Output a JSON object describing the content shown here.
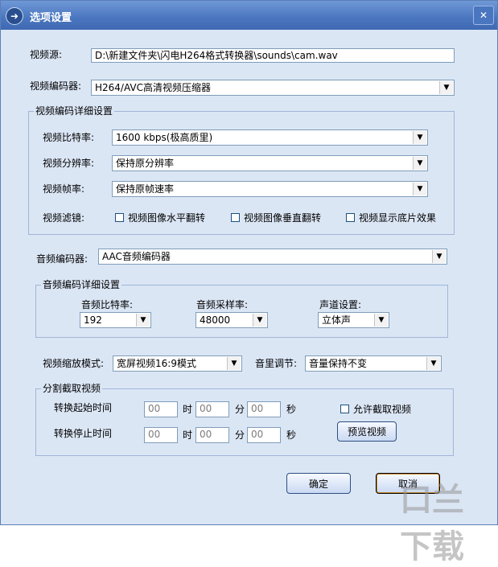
{
  "window": {
    "title": "选项设置"
  },
  "video_source": {
    "label": "视频源:",
    "value": "D:\\新建文件夹\\闪电H264格式转换器\\sounds\\cam.wav"
  },
  "video_encoder": {
    "label": "视频编码器:",
    "value": "H264/AVC高清视频压缩器"
  },
  "video_detail": {
    "title": "视频编码详细设置",
    "bitrate": {
      "label": "视频比特率:",
      "value": "1600 kbps(极高质里)"
    },
    "resolution": {
      "label": "视频分辨率:",
      "value": "保持原分辨率"
    },
    "framerate": {
      "label": "视频帧率:",
      "value": "保持原帧速率"
    },
    "filter": {
      "label": "视频滤镜:",
      "options": [
        "视频图像水平翻转",
        "视频图像垂直翻转",
        "视频显示底片效果"
      ]
    }
  },
  "audio_encoder": {
    "label": "音频编码器:",
    "value": "AAC音频编码器"
  },
  "audio_detail": {
    "title": "音频编码详细设置",
    "bitrate": {
      "label": "音频比特率:",
      "value": "192"
    },
    "samplerate": {
      "label": "音频采样率:",
      "value": "48000"
    },
    "channel": {
      "label": "声道设置:",
      "value": "立体声"
    }
  },
  "zoom_mode": {
    "label": "视频缩放模式:",
    "value": "宽屏视频16:9模式"
  },
  "volume": {
    "label": "音里调节:",
    "value": "音量保持不变"
  },
  "split": {
    "title": "分割截取视频",
    "start_label": "转换起始时间",
    "end_label": "转换停止时间",
    "start": {
      "h": "00",
      "m": "00",
      "s": "00"
    },
    "end": {
      "h": "00",
      "m": "00",
      "s": "00"
    },
    "unit_h": "时",
    "unit_m": "分",
    "unit_s": "秒",
    "allow_label": "允许截取视频",
    "preview_label": "预览视频"
  },
  "buttons": {
    "ok": "确定",
    "cancel": "取消"
  },
  "watermark": "口兰 下载"
}
